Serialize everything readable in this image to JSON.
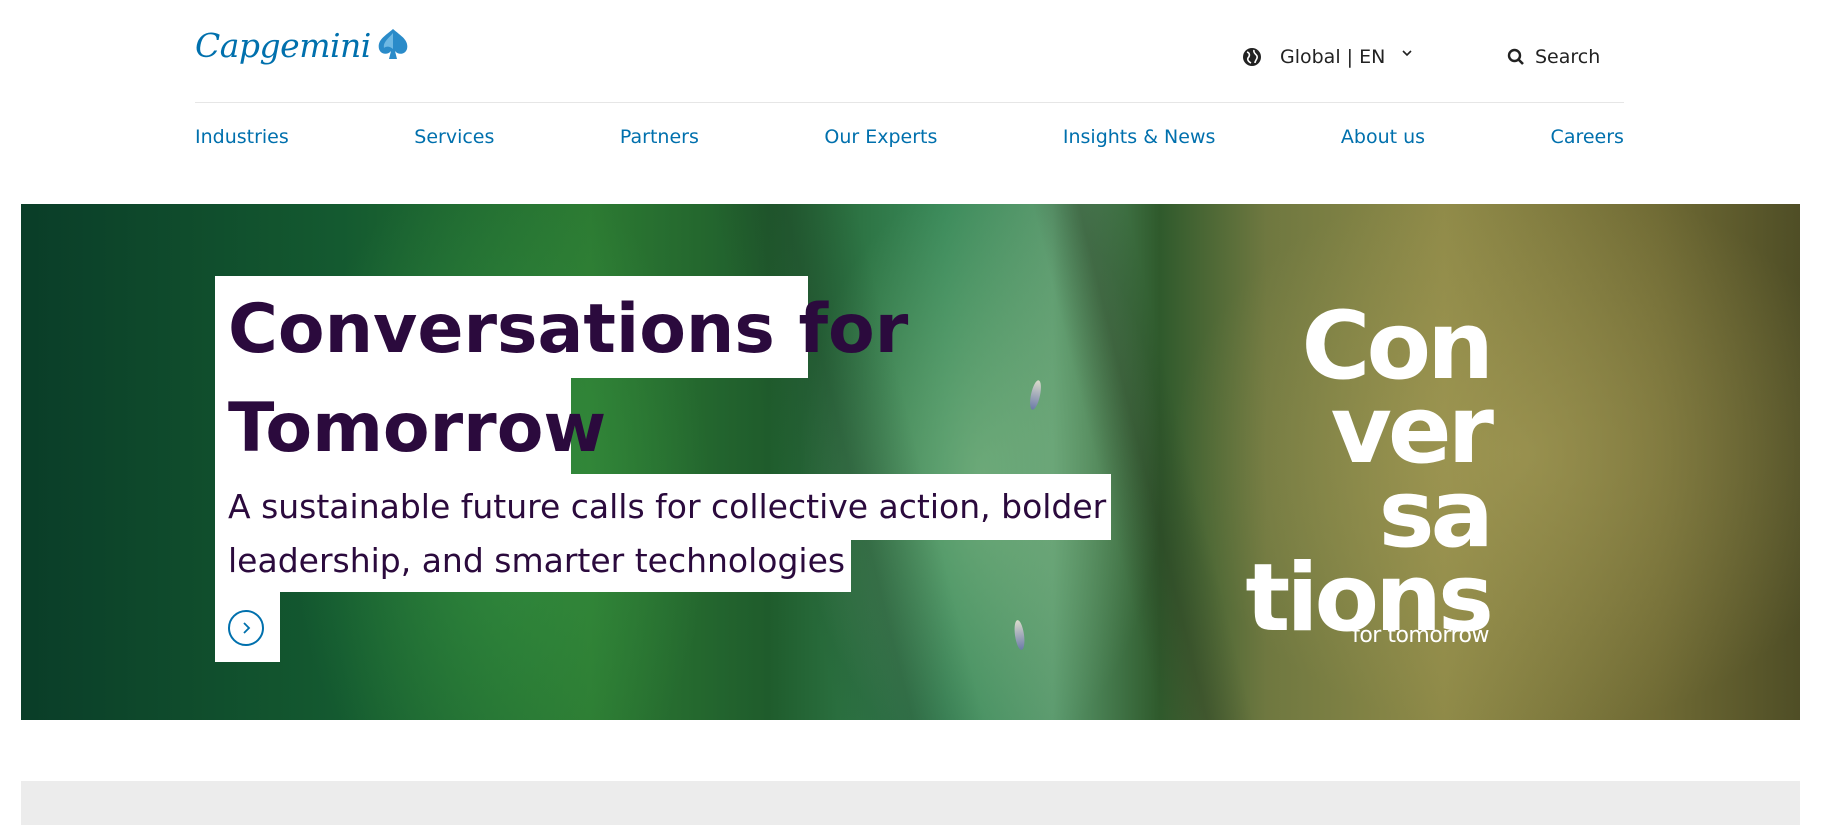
{
  "brand": {
    "logo_text": "Capgemini",
    "color": "#0070ad"
  },
  "header": {
    "region_label": "Global | EN",
    "search_label": "Search"
  },
  "nav": {
    "items": [
      "Industries",
      "Services",
      "Partners",
      "Our Experts",
      "Insights & News",
      "About us",
      "Careers"
    ]
  },
  "hero": {
    "title_line1": "Conversations for",
    "title_line2": "Tomorrow",
    "subtitle_line1": "A sustainable future calls for collective action, bolder",
    "subtitle_line2": "leadership, and smarter technologies",
    "brand_lines": [
      "Con",
      "ver",
      "sa",
      "tions"
    ],
    "brand_sub": "for tomorrow",
    "title_color": "#2b0a3d"
  },
  "icons": {
    "region": "globe-icon",
    "region_toggle": "chevron-down-icon",
    "search": "search-icon",
    "cta": "chevron-right-icon"
  }
}
